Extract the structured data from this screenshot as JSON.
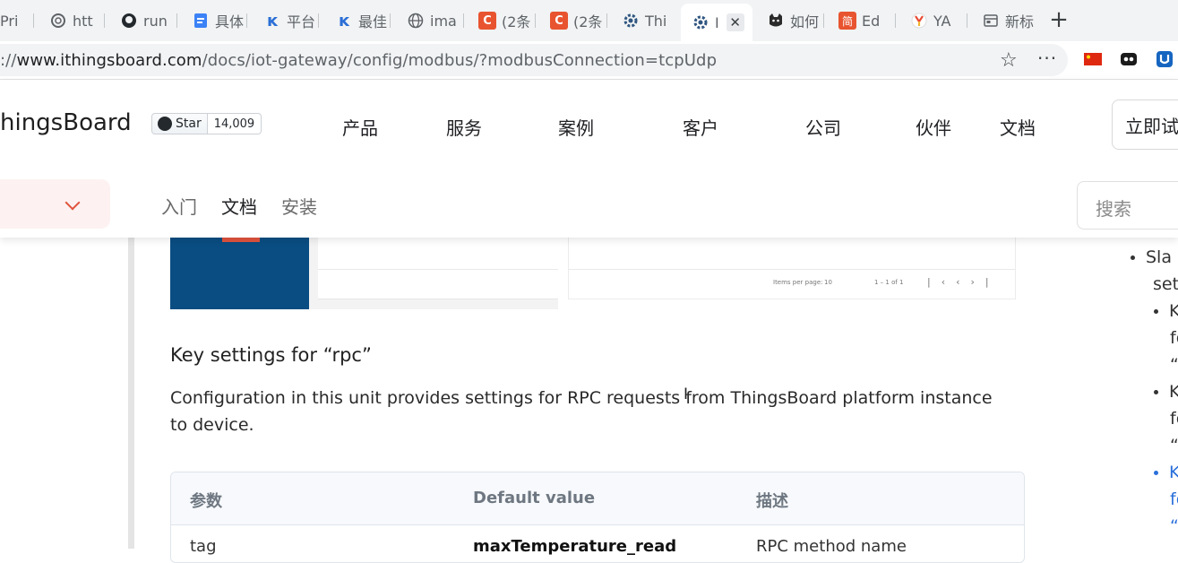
{
  "browser": {
    "tabs": [
      {
        "label": "Pri",
        "icon": "page-icon"
      },
      {
        "label": "htt",
        "icon": "chatgpt-icon"
      },
      {
        "label": "run",
        "icon": "github-icon"
      },
      {
        "label": "具体",
        "icon": "doc-icon"
      },
      {
        "label": "平台",
        "icon": "k-icon"
      },
      {
        "label": "最佳",
        "icon": "k-icon"
      },
      {
        "label": "ima",
        "icon": "globe-icon"
      },
      {
        "label": "(2条",
        "icon": "csdn-icon"
      },
      {
        "label": "(2条",
        "icon": "csdn-icon"
      },
      {
        "label": "Thi",
        "icon": "thingsboard-icon"
      },
      {
        "label": "I",
        "icon": "thingsboard-icon"
      },
      {
        "label": "如何",
        "icon": "cat-icon"
      },
      {
        "label": "Ed",
        "icon": "jian-icon"
      },
      {
        "label": "YA",
        "icon": "yandex-icon"
      },
      {
        "label": "新标",
        "icon": "newtab-page-icon"
      }
    ],
    "new_tab_symbol": "+",
    "close_symbol": "✕",
    "url_prefix": "://",
    "url_host": "www.ithingsboard.com",
    "url_path": "/docs/iot-gateway/config/modbus/?modbusConnection=tcpUdp",
    "star_symbol": "☆",
    "more_symbol": "···",
    "jian_glyph": "简"
  },
  "header": {
    "brand": "hingsBoard",
    "github": {
      "star_label": "Star",
      "count": "14,009"
    },
    "nav": [
      "产品",
      "服务",
      "案例",
      "客户",
      "公司",
      "伙伴",
      "文档"
    ],
    "cta": "立即试",
    "subnav": [
      "入门",
      "文档",
      "安装"
    ],
    "search_placeholder": "搜索"
  },
  "content": {
    "pager": {
      "items_per_page": "Items per page:",
      "per_page_value": "10",
      "range": "1 – 1 of 1"
    },
    "section_title": "Key settings for “rpc”",
    "paragraph": "Configuration in this unit provides settings for RPC requests from ThingsBoard platform instance to device.",
    "table": {
      "headers": [
        "参数",
        "Default value",
        "描述"
      ],
      "rows": [
        [
          "tag",
          "maxTemperature_read",
          "RPC method name"
        ]
      ]
    }
  },
  "toc": {
    "lines": [
      "Sla",
      "set",
      "K",
      "fo",
      "“a",
      "K",
      "fo",
      "“",
      "K",
      "fo",
      "“"
    ]
  },
  "colors": {
    "accent": "#e0533d",
    "brand_blue": "#0a4d82",
    "link_blue": "#2a6fdb"
  }
}
